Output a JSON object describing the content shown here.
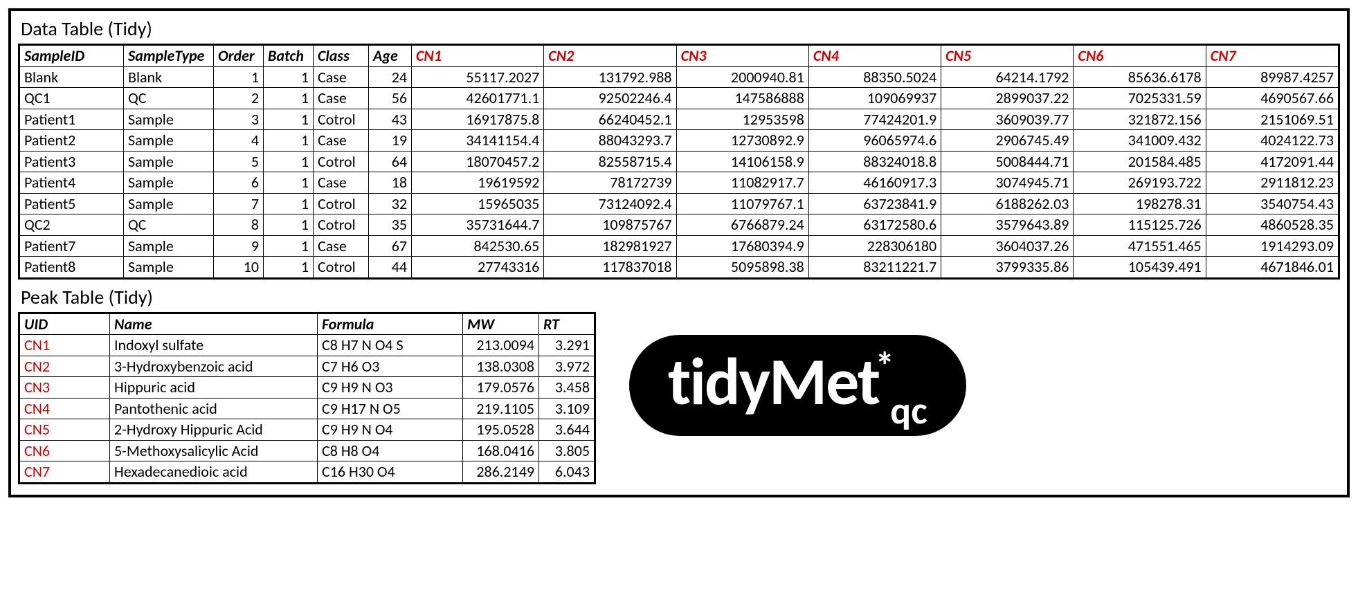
{
  "dataTable": {
    "title": "Data Table (Tidy)",
    "metaHeaders": [
      "SampleID",
      "SampleType",
      "Order",
      "Batch",
      "Class",
      "Age"
    ],
    "cnHeaders": [
      "CN1",
      "CN2",
      "CN3",
      "CN4",
      "CN5",
      "CN6",
      "CN7"
    ],
    "rows": [
      {
        "SampleID": "Blank",
        "SampleType": "Blank",
        "Order": "1",
        "Batch": "1",
        "Class": "Case",
        "Age": "24",
        "CN": [
          "55117.2027",
          "131792.988",
          "2000940.81",
          "88350.5024",
          "64214.1792",
          "85636.6178",
          "89987.4257"
        ]
      },
      {
        "SampleID": "QC1",
        "SampleType": "QC",
        "Order": "2",
        "Batch": "1",
        "Class": "Case",
        "Age": "56",
        "CN": [
          "42601771.1",
          "92502246.4",
          "147586888",
          "109069937",
          "2899037.22",
          "7025331.59",
          "4690567.66"
        ]
      },
      {
        "SampleID": "Patient1",
        "SampleType": "Sample",
        "Order": "3",
        "Batch": "1",
        "Class": "Cotrol",
        "Age": "43",
        "CN": [
          "16917875.8",
          "66240452.1",
          "12953598",
          "77424201.9",
          "3609039.77",
          "321872.156",
          "2151069.51"
        ]
      },
      {
        "SampleID": "Patient2",
        "SampleType": "Sample",
        "Order": "4",
        "Batch": "1",
        "Class": "Case",
        "Age": "19",
        "CN": [
          "34141154.4",
          "88043293.7",
          "12730892.9",
          "96065974.6",
          "2906745.49",
          "341009.432",
          "4024122.73"
        ]
      },
      {
        "SampleID": "Patient3",
        "SampleType": "Sample",
        "Order": "5",
        "Batch": "1",
        "Class": "Cotrol",
        "Age": "64",
        "CN": [
          "18070457.2",
          "82558715.4",
          "14106158.9",
          "88324018.8",
          "5008444.71",
          "201584.485",
          "4172091.44"
        ]
      },
      {
        "SampleID": "Patient4",
        "SampleType": "Sample",
        "Order": "6",
        "Batch": "1",
        "Class": "Case",
        "Age": "18",
        "CN": [
          "19619592",
          "78172739",
          "11082917.7",
          "46160917.3",
          "3074945.71",
          "269193.722",
          "2911812.23"
        ]
      },
      {
        "SampleID": "Patient5",
        "SampleType": "Sample",
        "Order": "7",
        "Batch": "1",
        "Class": "Cotrol",
        "Age": "32",
        "CN": [
          "15965035",
          "73124092.4",
          "11079767.1",
          "63723841.9",
          "6188262.03",
          "198278.31",
          "3540754.43"
        ]
      },
      {
        "SampleID": "QC2",
        "SampleType": "QC",
        "Order": "8",
        "Batch": "1",
        "Class": "Cotrol",
        "Age": "35",
        "CN": [
          "35731644.7",
          "109875767",
          "6766879.24",
          "63172580.6",
          "3579643.89",
          "115125.726",
          "4860528.35"
        ]
      },
      {
        "SampleID": "Patient7",
        "SampleType": "Sample",
        "Order": "9",
        "Batch": "1",
        "Class": "Case",
        "Age": "67",
        "CN": [
          "842530.65",
          "182981927",
          "17680394.9",
          "228306180",
          "3604037.26",
          "471551.465",
          "1914293.09"
        ]
      },
      {
        "SampleID": "Patient8",
        "SampleType": "Sample",
        "Order": "10",
        "Batch": "1",
        "Class": "Cotrol",
        "Age": "44",
        "CN": [
          "27743316",
          "117837018",
          "5095898.38",
          "83211221.7",
          "3799335.86",
          "105439.491",
          "4671846.01"
        ]
      }
    ]
  },
  "peakTable": {
    "title": "Peak Table (Tidy)",
    "headers": [
      "UID",
      "Name",
      "Formula",
      "MW",
      "RT"
    ],
    "rows": [
      {
        "UID": "CN1",
        "Name": "Indoxyl sulfate",
        "Formula": "C8 H7 N O4 S",
        "MW": "213.0094",
        "RT": "3.291"
      },
      {
        "UID": "CN2",
        "Name": "3-Hydroxybenzoic acid",
        "Formula": "C7 H6 O3",
        "MW": "138.0308",
        "RT": "3.972"
      },
      {
        "UID": "CN3",
        "Name": "Hippuric acid",
        "Formula": "C9 H9 N O3",
        "MW": "179.0576",
        "RT": "3.458"
      },
      {
        "UID": "CN4",
        "Name": "Pantothenic acid",
        "Formula": "C9 H17 N O5",
        "MW": "219.1105",
        "RT": "3.109"
      },
      {
        "UID": "CN5",
        "Name": "2-Hydroxy Hippuric Acid",
        "Formula": "C9 H9 N O4",
        "MW": "195.0528",
        "RT": "3.644"
      },
      {
        "UID": "CN6",
        "Name": "5-Methoxysalicylic Acid",
        "Formula": "C8 H8 O4",
        "MW": "168.0416",
        "RT": "3.805"
      },
      {
        "UID": "CN7",
        "Name": "Hexadecanedioic acid",
        "Formula": "C16 H30 O4",
        "MW": "286.2149",
        "RT": "6.043"
      }
    ]
  },
  "logo": {
    "main": "tidyMet",
    "star": "*",
    "sub": "qc"
  }
}
